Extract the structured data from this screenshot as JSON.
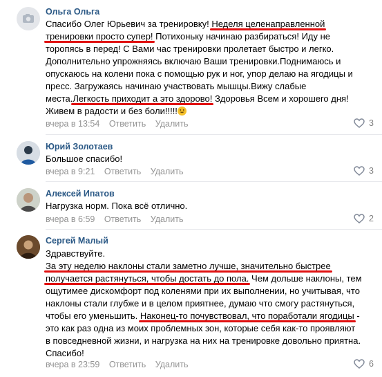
{
  "comments": [
    {
      "author": "Ольга Ольга",
      "lines": [
        [
          {
            "t": "Спасибо Олег Юрьевич за тренировку! "
          },
          {
            "t": "Неделя целенаправленной",
            "hl": true
          }
        ],
        [
          {
            "t": "тренировки просто супер!",
            "hl": true
          },
          {
            "t": " Потихоньку начинаю разбираться! Иду не"
          }
        ],
        [
          {
            "t": "торопясь в перед! С Вами час тренировки пролетает быстро и легко."
          }
        ],
        [
          {
            "t": "Дополнительно упрожняясь включаю Ваши тренировки.Поднимаюсь и"
          }
        ],
        [
          {
            "t": "опускаюсь на колени пока с помощью рук и ног, упор делаю на ягодицы и"
          }
        ],
        [
          {
            "t": "пресс. Загружаясь начинаю участвовать мышцы.Вижу слабые"
          }
        ],
        [
          {
            "t": "места."
          },
          {
            "t": "Легкость приходит а это здорово!",
            "hl": true
          },
          {
            "t": " Здоровья Всем и хорошего дня!"
          }
        ],
        [
          {
            "t": "Живем в радости и без боли!!!!!"
          },
          {
            "emoji": true
          }
        ]
      ],
      "time": "вчера в 13:54",
      "reply": "Ответить",
      "delete": "Удалить",
      "likes": "3"
    },
    {
      "author": "Юрий Золотаев",
      "lines": [
        [
          {
            "t": "Большое спасибо!"
          }
        ]
      ],
      "time": "вчера в 9:21",
      "reply": "Ответить",
      "delete": "Удалить",
      "likes": "3"
    },
    {
      "author": "Алексей Ипатов",
      "lines": [
        [
          {
            "t": "Нагрузка норм. Пока всё отлично."
          }
        ]
      ],
      "time": "вчера в 6:59",
      "reply": "Ответить",
      "delete": "Удалить",
      "likes": "2"
    },
    {
      "author": "Сергей Малый",
      "lines": [
        [
          {
            "t": "Здравствуйте."
          }
        ],
        [
          {
            "t": "За эту неделю наклоны стали заметно лучше, значительно быстрее",
            "hl": true
          }
        ],
        [
          {
            "t": "получается растянуться, чтобы достать до пола.",
            "hl": true
          },
          {
            "t": " Чем дольше наклоны, тем"
          }
        ],
        [
          {
            "t": "ощутимее дискомфорт под коленями при их выполнении, но учитывая, что"
          }
        ],
        [
          {
            "t": "наклоны стали глубже и в целом приятнее, думаю что смогу растянуться,"
          }
        ],
        [
          {
            "t": "чтобы его уменьшить. "
          },
          {
            "t": "Наконец-то почувствовал, что поработали ягодицы",
            "hl": true
          },
          {
            "t": " -"
          }
        ],
        [
          {
            "t": "это как раз одна из моих проблемных зон, которые себя как-то проявляют"
          }
        ],
        [
          {
            "t": "в повседневной жизни, и нагрузка на них на тренировке довольно приятна."
          }
        ],
        [
          {
            "t": "Спасибо!"
          }
        ]
      ],
      "time": "вчера в 23:59",
      "reply": "Ответить",
      "delete": "Удалить",
      "likes": "6"
    }
  ]
}
